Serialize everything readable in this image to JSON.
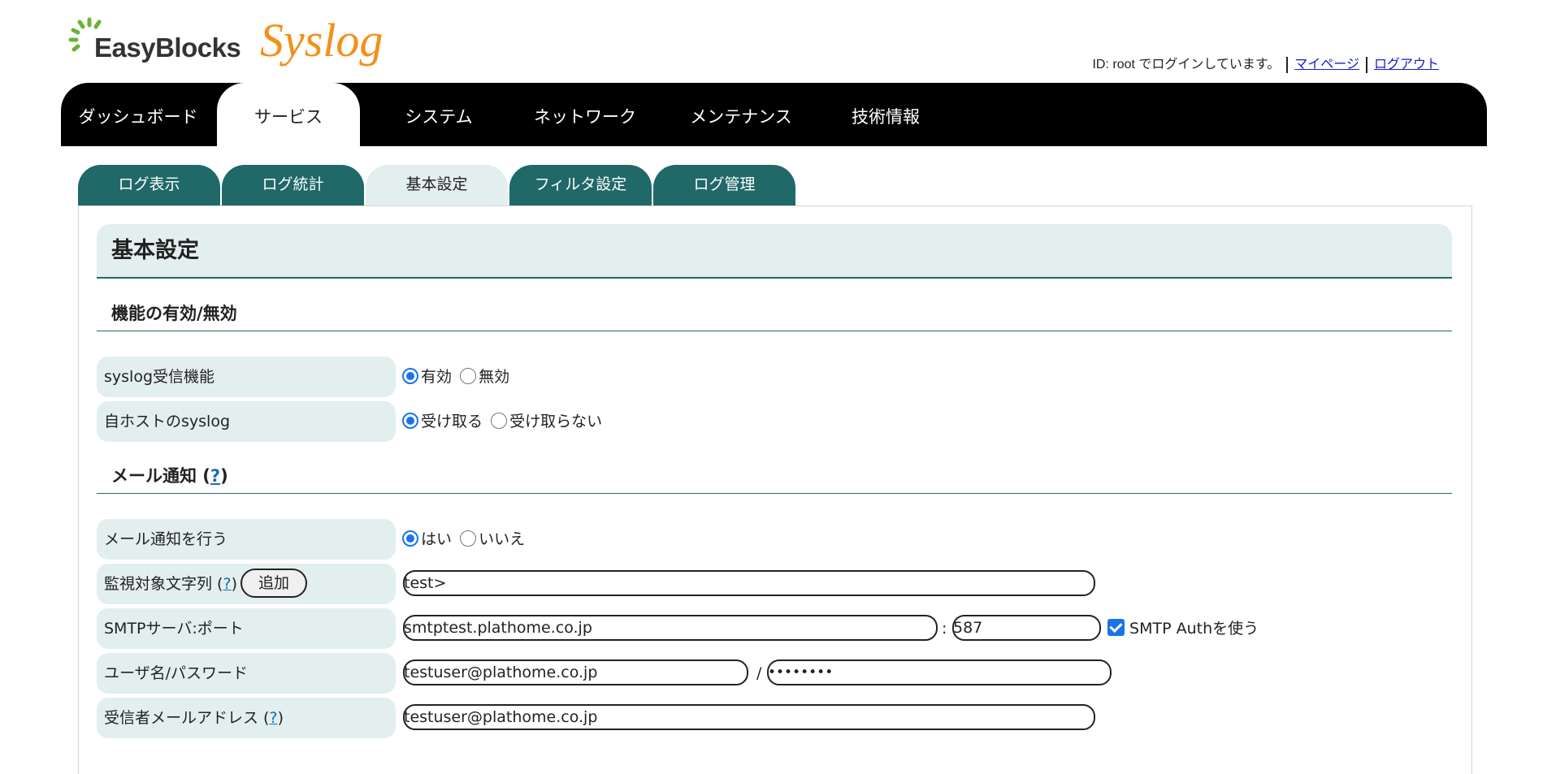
{
  "brand": {
    "logo_text": "EasyBlocks",
    "product": "Syslog"
  },
  "login": {
    "status_text": "ID: root でログインしています。",
    "mypage_label": "マイページ",
    "logout_label": "ログアウト"
  },
  "nav": {
    "items": [
      "ダッシュボード",
      "サービス",
      "システム",
      "ネットワーク",
      "メンテナンス",
      "技術情報"
    ],
    "active": "サービス"
  },
  "subtabs": {
    "items": [
      "ログ表示",
      "ログ統計",
      "基本設定",
      "フィルタ設定",
      "ログ管理"
    ],
    "active": "基本設定"
  },
  "page": {
    "title": "基本設定"
  },
  "sections": {
    "feature": {
      "title": "機能の有効/無効",
      "syslog_receive": {
        "label": "syslog受信機能",
        "opt_on": "有効",
        "opt_off": "無効",
        "selected": "有効"
      },
      "local_syslog": {
        "label": "自ホストのsyslog",
        "opt_on": "受け取る",
        "opt_off": "受け取らない",
        "selected": "受け取る"
      }
    },
    "mail": {
      "title": "メール通知",
      "help": "?",
      "notify": {
        "label": "メール通知を行う",
        "opt_on": "はい",
        "opt_off": "いいえ",
        "selected": "はい"
      },
      "watch": {
        "label": "監視対象文字列",
        "help": "?",
        "add_label": "追加",
        "value": "test>"
      },
      "smtp": {
        "label": "SMTPサーバ:ポート",
        "server": "smtptest.plathome.co.jp",
        "port": "587",
        "auth_label": "SMTP Authを使う",
        "auth_checked": true
      },
      "user": {
        "label": "ユーザ名/パスワード",
        "username": "testuser@plathome.co.jp",
        "password_mask": "••••••••"
      },
      "recipient": {
        "label": "受信者メールアドレス",
        "help": "?",
        "value": "testuser@plathome.co.jp"
      }
    }
  },
  "colors": {
    "nav_bg": "#000000",
    "tab_teal": "#216868",
    "panel_light": "#e3efee",
    "accent_blue": "#1a73e8",
    "brand_orange": "#f39019",
    "brand_green": "#6ab23a"
  }
}
